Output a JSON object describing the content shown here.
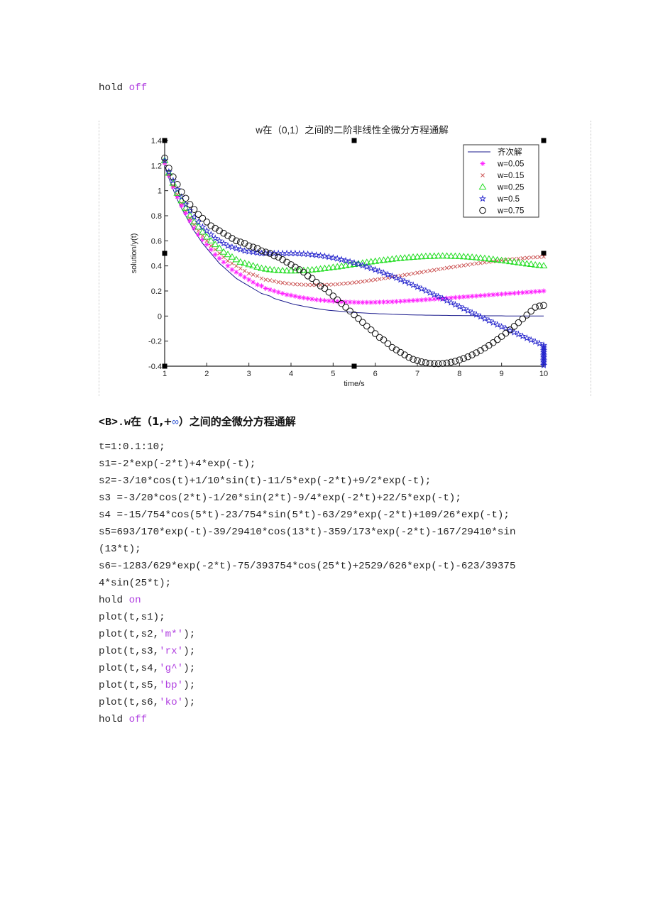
{
  "top_code": {
    "hold_kw": "hold",
    "hold_state": "off"
  },
  "section_heading": {
    "prefix": "<B>.w",
    "mid": "在（1,+",
    "inf": "∞",
    "suffix": "）之间的全微分方程通解"
  },
  "code_lines": [
    "t=1:0.1:10;",
    "s1=-2*exp(-2*t)+4*exp(-t);",
    "s2=-3/10*cos(t)+1/10*sin(t)-11/5*exp(-2*t)+9/2*exp(-t);",
    "s3 =-3/20*cos(2*t)-1/20*sin(2*t)-9/4*exp(-2*t)+22/5*exp(-t);",
    "s4 =-15/754*cos(5*t)-23/754*sin(5*t)-63/29*exp(-2*t)+109/26*exp(-t);",
    "s5=693/170*exp(-t)-39/29410*cos(13*t)-359/173*exp(-2*t)-167/29410*sin",
    "(13*t);",
    "s6=-1283/629*exp(-2*t)-75/393754*cos(25*t)+2529/626*exp(-t)-623/39375",
    "4*sin(25*t);"
  ],
  "hold_on": {
    "kw": "hold",
    "state": "on"
  },
  "plot_lines": [
    {
      "pre": "plot(t,s1);",
      "spec": "",
      "post": ""
    },
    {
      "pre": "plot(t,s2,",
      "spec": "'m*'",
      "post": ");"
    },
    {
      "pre": "plot(t,s3,",
      "spec": "'rx'",
      "post": ");"
    },
    {
      "pre": "plot(t,s4,",
      "spec": "'g^'",
      "post": ");"
    },
    {
      "pre": "plot(t,s5,",
      "spec": "'bp'",
      "post": ");"
    },
    {
      "pre": "plot(t,s6,",
      "spec": "'ko'",
      "post": ");"
    }
  ],
  "hold_off": {
    "kw": "hold",
    "state": "off"
  },
  "chart_data": {
    "type": "line",
    "title": "w在（0,1）之间的二阶非线性全微分方程通解",
    "xlabel": "time/s",
    "ylabel": "solution/y(t)",
    "xlim": [
      1,
      10
    ],
    "ylim": [
      -0.4,
      1.4
    ],
    "xticks": [
      1,
      2,
      3,
      4,
      5,
      6,
      7,
      8,
      9,
      10
    ],
    "yticks": [
      -0.4,
      -0.2,
      0,
      0.2,
      0.4,
      0.6,
      0.8,
      1,
      1.2,
      1.4
    ],
    "ytick_labels": [
      "-0.4",
      "-0.2",
      "0",
      "0.2",
      "0.4",
      "0.6",
      "0.8",
      "1",
      "1.2",
      "1.4"
    ],
    "grid": false,
    "legend_position": "top-right",
    "x_start": 1,
    "x_step": 0.1,
    "series": [
      {
        "name": "齐次解",
        "color": "#1a1a8c",
        "marker": "line",
        "values": [
          1.2,
          1.1,
          1.01,
          0.93,
          0.86,
          0.8,
          0.74,
          0.68,
          0.63,
          0.58,
          0.54,
          0.5,
          0.46,
          0.42,
          0.39,
          0.36,
          0.33,
          0.3,
          0.28,
          0.26,
          0.24,
          0.22,
          0.2,
          0.18,
          0.17,
          0.16,
          0.14,
          0.13,
          0.12,
          0.11,
          0.1,
          0.09,
          0.085,
          0.078,
          0.072,
          0.066,
          0.06,
          0.055,
          0.05,
          0.046,
          0.043,
          0.04,
          0.037,
          0.034,
          0.031,
          0.029,
          0.027,
          0.025,
          0.023,
          0.021,
          0.02,
          0.018,
          0.017,
          0.016,
          0.014,
          0.013,
          0.012,
          0.011,
          0.01,
          0.009,
          0.008,
          0.008,
          0.007,
          0.007,
          0.006,
          0.006,
          0.005,
          0.005,
          0.004,
          0.004,
          0.004,
          0.003,
          0.003,
          0.003,
          0.003,
          0.002,
          0.002,
          0.002,
          0.002,
          0.002,
          0.002,
          0.001,
          0.001,
          0.001,
          0.001,
          0.001,
          0.001,
          0.001,
          0.001,
          0.001,
          0.0
        ]
      },
      {
        "name": "w=0.05",
        "color": "#ff22ff",
        "marker": "star",
        "values": [
          1.22,
          1.12,
          1.03,
          0.95,
          0.88,
          0.82,
          0.76,
          0.7,
          0.65,
          0.61,
          0.57,
          0.53,
          0.49,
          0.46,
          0.43,
          0.4,
          0.37,
          0.35,
          0.33,
          0.31,
          0.29,
          0.27,
          0.25,
          0.24,
          0.22,
          0.21,
          0.2,
          0.19,
          0.18,
          0.17,
          0.165,
          0.158,
          0.15,
          0.145,
          0.14,
          0.135,
          0.13,
          0.127,
          0.124,
          0.121,
          0.118,
          0.116,
          0.114,
          0.112,
          0.111,
          0.11,
          0.109,
          0.109,
          0.109,
          0.109,
          0.11,
          0.111,
          0.112,
          0.113,
          0.114,
          0.116,
          0.118,
          0.12,
          0.122,
          0.124,
          0.126,
          0.128,
          0.131,
          0.133,
          0.135,
          0.138,
          0.14,
          0.143,
          0.145,
          0.148,
          0.15,
          0.153,
          0.155,
          0.158,
          0.16,
          0.163,
          0.165,
          0.168,
          0.17,
          0.173,
          0.175,
          0.178,
          0.18,
          0.182,
          0.185,
          0.187,
          0.19,
          0.192,
          0.195,
          0.197,
          0.2
        ]
      },
      {
        "name": "w=0.15",
        "color": "#cc5555",
        "marker": "x",
        "values": [
          1.23,
          1.13,
          1.04,
          0.97,
          0.9,
          0.84,
          0.78,
          0.73,
          0.68,
          0.64,
          0.6,
          0.56,
          0.53,
          0.5,
          0.47,
          0.44,
          0.42,
          0.4,
          0.38,
          0.36,
          0.34,
          0.33,
          0.32,
          0.3,
          0.29,
          0.285,
          0.278,
          0.27,
          0.265,
          0.26,
          0.257,
          0.254,
          0.252,
          0.25,
          0.249,
          0.248,
          0.248,
          0.248,
          0.249,
          0.25,
          0.252,
          0.254,
          0.257,
          0.26,
          0.263,
          0.267,
          0.271,
          0.275,
          0.28,
          0.285,
          0.29,
          0.295,
          0.3,
          0.305,
          0.311,
          0.316,
          0.322,
          0.328,
          0.333,
          0.339,
          0.345,
          0.35,
          0.356,
          0.362,
          0.367,
          0.373,
          0.378,
          0.384,
          0.389,
          0.394,
          0.399,
          0.404,
          0.409,
          0.414,
          0.419,
          0.423,
          0.428,
          0.432,
          0.436,
          0.44,
          0.444,
          0.448,
          0.451,
          0.455,
          0.458,
          0.461,
          0.464,
          0.467,
          0.469,
          0.471,
          0.473
        ]
      },
      {
        "name": "w=0.25",
        "color": "#22dd22",
        "marker": "triangle",
        "values": [
          1.24,
          1.14,
          1.06,
          0.98,
          0.92,
          0.86,
          0.8,
          0.75,
          0.71,
          0.67,
          0.63,
          0.6,
          0.57,
          0.54,
          0.51,
          0.49,
          0.47,
          0.45,
          0.43,
          0.42,
          0.41,
          0.4,
          0.39,
          0.38,
          0.375,
          0.37,
          0.366,
          0.363,
          0.361,
          0.36,
          0.36,
          0.36,
          0.361,
          0.363,
          0.365,
          0.368,
          0.371,
          0.375,
          0.379,
          0.383,
          0.388,
          0.392,
          0.397,
          0.402,
          0.407,
          0.412,
          0.417,
          0.422,
          0.427,
          0.432,
          0.436,
          0.441,
          0.445,
          0.449,
          0.453,
          0.457,
          0.46,
          0.463,
          0.466,
          0.469,
          0.471,
          0.473,
          0.475,
          0.476,
          0.477,
          0.478,
          0.478,
          0.478,
          0.477,
          0.476,
          0.475,
          0.473,
          0.471,
          0.468,
          0.465,
          0.462,
          0.459,
          0.455,
          0.451,
          0.447,
          0.443,
          0.439,
          0.434,
          0.43,
          0.425,
          0.421,
          0.416,
          0.412,
          0.407,
          0.403,
          0.4
        ]
      },
      {
        "name": "w=0.5",
        "color": "#2222cc",
        "marker": "pentagram",
        "values": [
          1.24,
          1.15,
          1.08,
          1.01,
          0.95,
          0.89,
          0.84,
          0.79,
          0.75,
          0.71,
          0.68,
          0.65,
          0.62,
          0.6,
          0.58,
          0.56,
          0.55,
          0.54,
          0.53,
          0.52,
          0.515,
          0.51,
          0.505,
          0.5,
          0.5,
          0.5,
          0.5,
          0.5,
          0.5,
          0.5,
          0.5,
          0.5,
          0.498,
          0.496,
          0.494,
          0.49,
          0.486,
          0.482,
          0.477,
          0.471,
          0.465,
          0.458,
          0.45,
          0.442,
          0.433,
          0.424,
          0.414,
          0.403,
          0.392,
          0.381,
          0.369,
          0.357,
          0.344,
          0.331,
          0.318,
          0.304,
          0.29,
          0.276,
          0.262,
          0.247,
          0.232,
          0.217,
          0.202,
          0.186,
          0.171,
          0.155,
          0.139,
          0.123,
          0.107,
          0.091,
          0.075,
          0.059,
          0.043,
          0.027,
          0.011,
          -0.005,
          -0.021,
          -0.037,
          -0.053,
          -0.069,
          -0.085,
          -0.1,
          -0.116,
          -0.131,
          -0.146,
          -0.161,
          -0.176,
          -0.191,
          -0.205,
          -0.219,
          -0.233,
          -0.247,
          -0.261,
          -0.275,
          -0.289,
          -0.303,
          -0.316,
          -0.329,
          -0.342,
          -0.355,
          -0.368,
          -0.381,
          -0.393
        ]
      },
      {
        "name": "w=0.75",
        "color": "#111111",
        "marker": "circle",
        "values": [
          1.26,
          1.18,
          1.11,
          1.05,
          0.99,
          0.94,
          0.89,
          0.85,
          0.81,
          0.78,
          0.75,
          0.72,
          0.7,
          0.68,
          0.66,
          0.64,
          0.62,
          0.6,
          0.59,
          0.58,
          0.56,
          0.55,
          0.54,
          0.52,
          0.51,
          0.5,
          0.48,
          0.47,
          0.45,
          0.43,
          0.41,
          0.39,
          0.37,
          0.35,
          0.32,
          0.3,
          0.27,
          0.24,
          0.22,
          0.19,
          0.16,
          0.13,
          0.1,
          0.07,
          0.04,
          0.01,
          -0.02,
          -0.05,
          -0.08,
          -0.11,
          -0.14,
          -0.17,
          -0.19,
          -0.22,
          -0.25,
          -0.27,
          -0.29,
          -0.31,
          -0.33,
          -0.345,
          -0.355,
          -0.365,
          -0.372,
          -0.377,
          -0.38,
          -0.38,
          -0.378,
          -0.374,
          -0.368,
          -0.36,
          -0.35,
          -0.338,
          -0.325,
          -0.31,
          -0.293,
          -0.275,
          -0.255,
          -0.234,
          -0.212,
          -0.188,
          -0.163,
          -0.137,
          -0.11,
          -0.082,
          -0.053,
          -0.023,
          0.008,
          0.039,
          0.07,
          0.08,
          0.085
        ]
      }
    ]
  }
}
